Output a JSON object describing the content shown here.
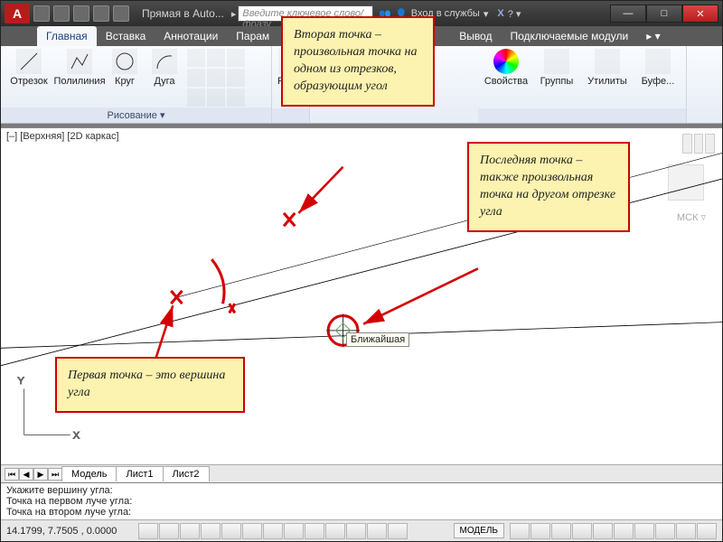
{
  "titlebar": {
    "logo_letter": "A",
    "app_title": "Прямая в Auto...",
    "search_placeholder": "Введите ключевое слово/фразу",
    "login_label": "Вход в службы"
  },
  "tabs": [
    {
      "label": "Главная",
      "active": true
    },
    {
      "label": "Вставка"
    },
    {
      "label": "Аннотации"
    },
    {
      "label": "Парам"
    },
    {
      "label": "Вывод"
    },
    {
      "label": "Подключаемые модули"
    }
  ],
  "ribbon": {
    "draw_panel_title": "Рисование ▾",
    "items": {
      "line": "Отрезок",
      "polyline": "Полилиния",
      "circle": "Круг",
      "arc": "Дуга",
      "edit": "Редак",
      "props": "Свойства",
      "groups": "Группы",
      "utilities": "Утилиты",
      "buffer": "Буфе..."
    }
  },
  "view_label": "[–] [Верхняя] [2D каркас]",
  "mck_label": "МСК ▿",
  "snap_tooltip": "Ближайшая",
  "callouts": {
    "first": "Первая точка – это вершина угла",
    "second": "Вторая точка – произвольная точка на одном из отрезков, образующим угол",
    "last": "Последняя точка – также произвольная точка на другом отрезке угла"
  },
  "model_tabs": {
    "model": "Модель",
    "sheet1": "Лист1",
    "sheet2": "Лист2"
  },
  "cmd_lines": [
    "Укажите вершину угла:",
    "Точка на первом луче угла:",
    "Точка на втором луче угла:"
  ],
  "status": {
    "coords": "14.1799, 7.7505 , 0.0000",
    "model_indicator": "МОДЕЛЬ"
  }
}
